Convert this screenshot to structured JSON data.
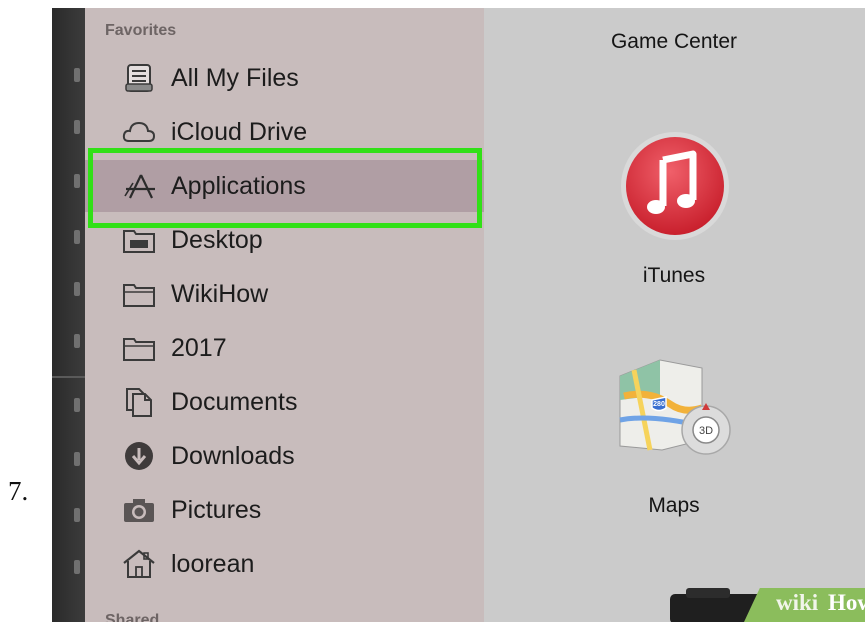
{
  "step": {
    "number": "7."
  },
  "sidebar": {
    "section_header": "Favorites",
    "next_section_header": "Shared",
    "items": [
      {
        "label": "All My Files",
        "icon": "all-my-files-icon",
        "selected": false
      },
      {
        "label": "iCloud Drive",
        "icon": "cloud-icon",
        "selected": false
      },
      {
        "label": "Applications",
        "icon": "applications-icon",
        "selected": true
      },
      {
        "label": "Desktop",
        "icon": "desktop-folder-icon",
        "selected": false
      },
      {
        "label": "WikiHow",
        "icon": "folder-icon",
        "selected": false
      },
      {
        "label": "2017",
        "icon": "folder-icon",
        "selected": false
      },
      {
        "label": "Documents",
        "icon": "documents-icon",
        "selected": false
      },
      {
        "label": "Downloads",
        "icon": "downloads-icon",
        "selected": false
      },
      {
        "label": "Pictures",
        "icon": "camera-icon",
        "selected": false
      },
      {
        "label": "loorean",
        "icon": "home-icon",
        "selected": false
      }
    ]
  },
  "content": {
    "apps": [
      {
        "label": "Game Center",
        "icon": "game-center-icon"
      },
      {
        "label": "iTunes",
        "icon": "itunes-icon"
      },
      {
        "label": "Maps",
        "icon": "maps-icon"
      }
    ],
    "maps_badge": "3D",
    "maps_shield": "280"
  },
  "watermark": {
    "wiki": "wiki",
    "how": "How"
  },
  "colors": {
    "highlight_border": "#31e017",
    "selected_row": "#b09ea4",
    "sidebar_bg": "#c8bcbc",
    "content_bg": "#cbcbcb",
    "itunes_red": "#e23a45"
  }
}
